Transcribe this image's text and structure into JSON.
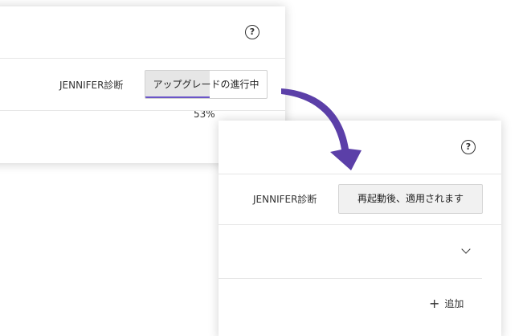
{
  "before": {
    "help_icon": "?",
    "diagnostics_label": "JENNIFER診断",
    "progress_label": "アップグレードの進行中",
    "progress_percent": 53,
    "progress_text": "53%",
    "add_icon": "+"
  },
  "after": {
    "help_icon": "?",
    "diagnostics_label": "JENNIFER診断",
    "restart_label": "再起動後、適用されます",
    "add_icon": "+",
    "add_label": "追加"
  },
  "colors": {
    "accent": "#6a55c8",
    "arrow": "#5b3fa8",
    "progress_fill": "#e6e6e6"
  },
  "icons": {
    "help": "help-icon",
    "chevron": "chevron-down-icon",
    "add": "plus-icon",
    "transition": "arrow-icon"
  }
}
